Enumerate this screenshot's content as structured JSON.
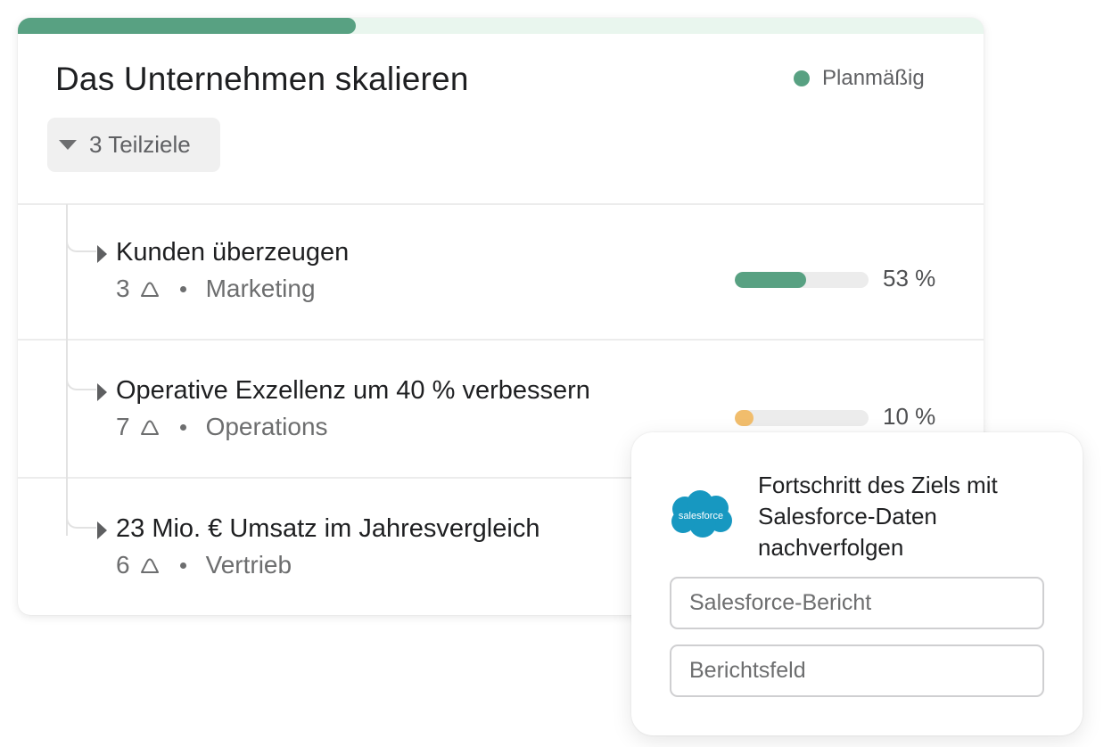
{
  "goal": {
    "title": "Das Unternehmen skalieren",
    "status_label": "Planmäßig",
    "status_color": "#58a182",
    "progress_fraction": 0.35,
    "subgoals_toggle_label": "3 Teilziele"
  },
  "subgoals": [
    {
      "title": "Kunden überzeugen",
      "count": "3",
      "team": "Marketing",
      "progress_percent": 53,
      "progress_label": "53 %",
      "bar_color": "#58a182"
    },
    {
      "title": "Operative Exzellenz um 40 % verbessern",
      "count": "7",
      "team": "Operations",
      "progress_percent": 10,
      "progress_label": "10 %",
      "bar_color": "#f1bd6c"
    },
    {
      "title": "23 Mio. € Umsatz im Jahresvergleich",
      "count": "6",
      "team": "Vertrieb"
    }
  ],
  "salesforce_panel": {
    "logo_text": "salesforce",
    "logo_color": "#1798c1",
    "heading": "Fortschritt des Ziels mit Salesforce-Daten nachverfolgen",
    "report_placeholder": "Salesforce-Bericht",
    "field_placeholder": "Berichtsfeld"
  }
}
